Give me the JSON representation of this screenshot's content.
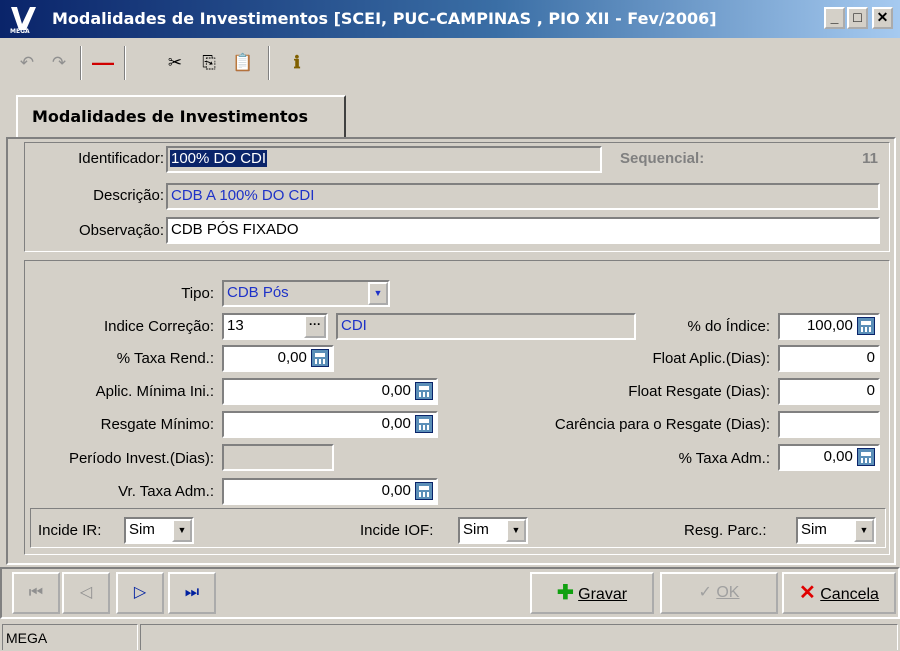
{
  "window": {
    "title": "Modalidades de Investimentos [SCEI, PUC-CAMPINAS , PIO XII - Fev/2006]",
    "logo_text": "MEGA",
    "controls": [
      "_",
      "□",
      "✕"
    ]
  },
  "toolbar": {
    "undo_icon": "↶",
    "redo_icon": "↷",
    "delete_icon": "—",
    "cut_icon": "✂",
    "copy_icon": "⎘",
    "paste_icon": "📋",
    "info_icon": "ℹ"
  },
  "tab": {
    "label": "Modalidades de Investimentos"
  },
  "header": {
    "identificador_label": "Identificador:",
    "identificador_value": "100% DO CDI",
    "sequencial_label": "Sequencial:",
    "sequencial_value": "11",
    "descricao_label": "Descrição:",
    "descricao_value": "CDB A 100% DO CDI",
    "observacao_label": "Observação:",
    "observacao_value": "CDB PÓS FIXADO"
  },
  "details": {
    "tipo_label": "Tipo:",
    "tipo_value": "CDB Pós",
    "indice_label": "Indice Correção:",
    "indice_value": "13",
    "indice_desc": "CDI",
    "pct_indice_label": "% do Índice:",
    "pct_indice_value": "100,00",
    "taxa_rend_label": "% Taxa Rend.:",
    "taxa_rend_value": "0,00",
    "float_aplic_label": "Float Aplic.(Dias):",
    "float_aplic_value": "0",
    "aplic_min_label": "Aplic. Mínima Ini.:",
    "aplic_min_value": "0,00",
    "float_resgate_label": "Float Resgate (Dias):",
    "float_resgate_value": "0",
    "resgate_min_label": "Resgate Mínimo:",
    "resgate_min_value": "0,00",
    "carencia_label": "Carência para o Resgate (Dias):",
    "carencia_value": "",
    "periodo_label": "Período Invest.(Dias):",
    "periodo_value": "",
    "taxa_adm_pct_label": "% Taxa Adm.:",
    "taxa_adm_pct_value": "0,00",
    "vr_taxa_adm_label": "Vr. Taxa Adm.:",
    "vr_taxa_adm_value": "0,00"
  },
  "flags": {
    "incide_ir_label": "Incide IR:",
    "incide_ir_value": "Sim",
    "incide_iof_label": "Incide IOF:",
    "incide_iof_value": "Sim",
    "resg_parc_label": "Resg. Parc.:",
    "resg_parc_value": "Sim"
  },
  "navigation": {
    "first_icon": "⏮",
    "prev_icon": "◁",
    "next_icon": "▷",
    "last_icon": "⏭"
  },
  "actions": {
    "gravar_label": "Gravar",
    "ok_label": "OK",
    "cancela_label": "Cancela"
  },
  "statusbar": {
    "text": "MEGA"
  }
}
